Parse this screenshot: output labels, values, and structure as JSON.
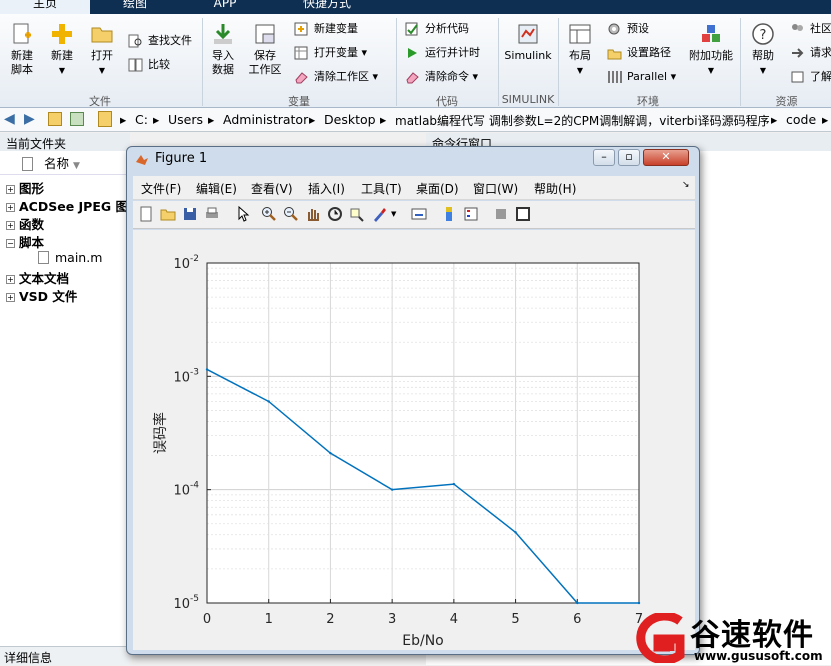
{
  "tabs": [
    "主页",
    "绘图",
    "APP",
    "快捷方式"
  ],
  "ribbon": {
    "new_script": "新建\n脚本",
    "new": "新建",
    "open": "打开",
    "find_files": "查找文件",
    "compare": "比较",
    "import": "导入\n数据",
    "save_ws": "保存\n工作区",
    "new_var": "新建变量",
    "open_var": "打开变量",
    "clear_ws": "清除工作区",
    "analyze": "分析代码",
    "run_time": "运行并计时",
    "clear_cmd": "清除命令",
    "simulink": "Simulink",
    "layout": "布局",
    "prefs": "预设",
    "set_path": "设置路径",
    "parallel": "Parallel",
    "addons": "附加功能",
    "help": "帮助",
    "community": "社区",
    "request": "请求",
    "learn": "了解",
    "groups": {
      "file": "文件",
      "variable": "变量",
      "code": "代码",
      "simulink": "SIMULINK",
      "env": "环境",
      "resources": "资源"
    }
  },
  "address": {
    "crumbs": [
      "C:",
      "Users",
      "Administrator",
      "Desktop",
      "matlab编程代写 调制参数L=2的CPM调制解调，viterbi译码源码程序",
      "code"
    ]
  },
  "file_browser": {
    "title": "当前文件夹",
    "column": "名称",
    "items": [
      {
        "label": "图形",
        "sign": "+"
      },
      {
        "label": "ACDSee JPEG 图像",
        "sign": "+"
      },
      {
        "label": "函数",
        "sign": "+"
      },
      {
        "label": "脚本",
        "sign": "−"
      },
      {
        "label": "文本文档",
        "sign": "+"
      },
      {
        "label": "VSD 文件",
        "sign": "+"
      }
    ],
    "file": "main.m",
    "details": "详细信息"
  },
  "command_window": {
    "title": "命令行窗口"
  },
  "figure": {
    "title": "Figure 1",
    "menu": [
      "文件(F)",
      "编辑(E)",
      "查看(V)",
      "插入(I)",
      "工具(T)",
      "桌面(D)",
      "窗口(W)",
      "帮助(H)"
    ]
  },
  "watermark": {
    "brand": "谷速软件",
    "url": "www.gususoft.com"
  },
  "colors": {
    "line": "#0072bd",
    "accent": "#0f2f52"
  },
  "chart_data": {
    "type": "line",
    "xlabel": "Eb/No",
    "ylabel": "误码率",
    "x": [
      0,
      1,
      2,
      3,
      4,
      5,
      6,
      7
    ],
    "y": [
      0.00115,
      0.0006,
      0.00021,
      0.0001,
      0.000112,
      4.2e-05,
      1e-05,
      1e-05
    ],
    "xlim": [
      0,
      7
    ],
    "ylim": [
      1e-05,
      0.01
    ],
    "yscale": "log",
    "grid": true,
    "xticks": [
      "0",
      "1",
      "2",
      "3",
      "4",
      "5",
      "6",
      "7"
    ],
    "yticks": [
      {
        "base": "10",
        "exp": "-5"
      },
      {
        "base": "10",
        "exp": "-4"
      },
      {
        "base": "10",
        "exp": "-3"
      },
      {
        "base": "10",
        "exp": "-2"
      }
    ]
  }
}
